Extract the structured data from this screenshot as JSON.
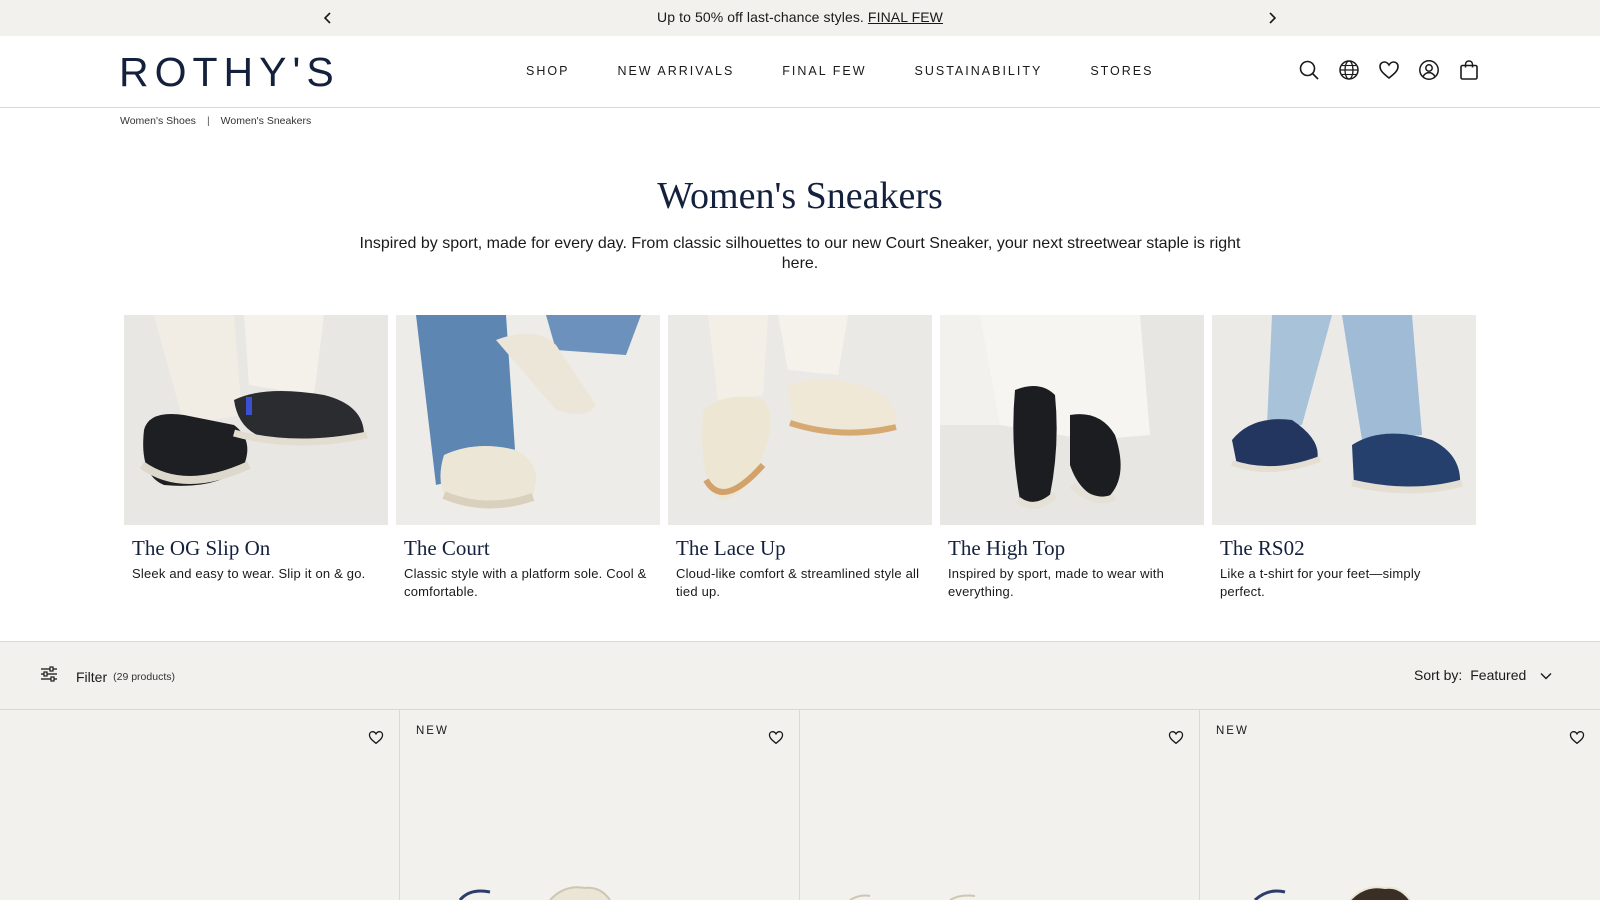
{
  "announcement": {
    "text": "Up to 50% off last-chance styles.",
    "link": "FINAL FEW"
  },
  "header": {
    "logo": "ROTHY'S",
    "nav": [
      "SHOP",
      "NEW ARRIVALS",
      "FINAL FEW",
      "SUSTAINABILITY",
      "STORES"
    ],
    "icons": [
      "search-icon",
      "globe-icon",
      "heart-icon",
      "account-icon",
      "bag-icon"
    ]
  },
  "breadcrumb": {
    "parent": "Women's Shoes",
    "separator": "|",
    "current": "Women's Sneakers"
  },
  "hero": {
    "title": "Women's Sneakers",
    "description": "Inspired by sport, made for every day. From classic silhouettes to our new Court Sneaker, your next streetwear staple is right here."
  },
  "tiles": [
    {
      "name": "The OG Slip On",
      "desc": "Sleek and easy to wear. Slip it on & go."
    },
    {
      "name": "The Court",
      "desc": "Classic style with a platform sole. Cool & comfortable."
    },
    {
      "name": "The Lace Up",
      "desc": "Cloud-like comfort & streamlined style all tied up."
    },
    {
      "name": "The High Top",
      "desc": "Inspired by sport, made to wear with everything."
    },
    {
      "name": "The RS02",
      "desc": "Like a t-shirt for your feet—simply perfect."
    }
  ],
  "filterbar": {
    "filter_label": "Filter",
    "count": "(29 products)",
    "sort_label": "Sort by:",
    "sort_value": "Featured"
  },
  "products": [
    {
      "badge": ""
    },
    {
      "badge": "NEW"
    },
    {
      "badge": ""
    },
    {
      "badge": "NEW"
    }
  ],
  "colors": {
    "navy": "#14213d",
    "panel": "#f2f1ee",
    "border": "#d9d9d9"
  }
}
